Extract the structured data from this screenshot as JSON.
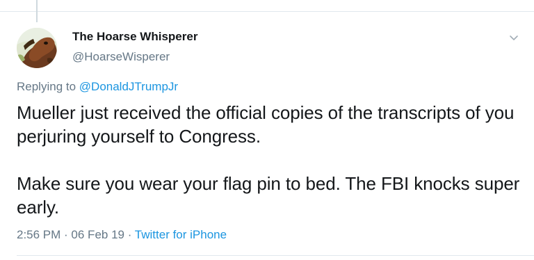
{
  "tweet": {
    "author": {
      "display_name": "The Hoarse Whisperer",
      "handle": "@HoarseWisperer",
      "avatar_icon": "horse-avatar"
    },
    "replying_to": {
      "prefix": "Replying to ",
      "mention": "@DonaldJTrumpJr"
    },
    "text": {
      "paragraph_1": "Mueller just received the official copies of the transcripts of you perjuring yourself to Congress.",
      "paragraph_2": "Make sure you wear your flag pin to bed. The FBI knocks super early."
    },
    "meta": {
      "time": "2:56 PM",
      "separator": " · ",
      "date": "06 Feb 19",
      "source": "Twitter for iPhone"
    },
    "menu_icon": "chevron-down-icon"
  },
  "colors": {
    "text_primary": "#14171a",
    "text_secondary": "#657786",
    "link": "#1b95e0",
    "divider": "#e1e8ed"
  }
}
